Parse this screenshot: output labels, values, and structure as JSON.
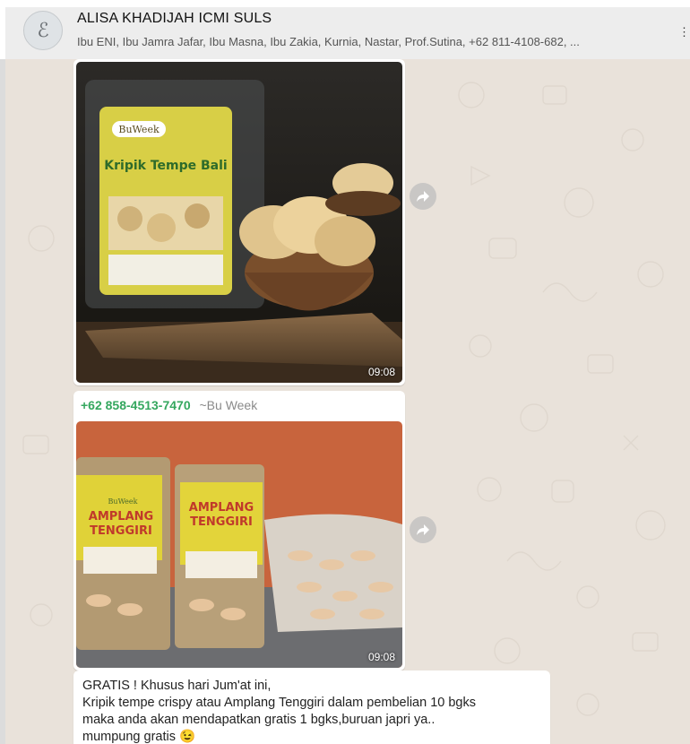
{
  "header": {
    "avatar_glyph": "ℰ",
    "title": "ALISA KHADIJAH ICMI SULS",
    "participants": "Ibu ENI, Ibu Jamra Jafar, Ibu Masna, Ibu Zakia, Kurnia, Nastar, Prof.Sutina, +62 811-4108-682, ..."
  },
  "messages": {
    "first_image": {
      "time": "09:08",
      "package_brand": "BuWeek",
      "package_label": "Kripik Tempe Bali"
    },
    "second": {
      "sender_phone": "+62 858-4513-7470",
      "sender_name": "~Bu Week",
      "time": "09:08",
      "package_brand": "BuWeek",
      "package_label_line1": "AMPLANG",
      "package_label_line2": "TENGGIRI"
    },
    "text": {
      "lines": [
        "GRATIS ! Khusus hari Jum'at ini,",
        "Kripik tempe crispy atau Amplang Tenggiri dalam pembelian 10 bgks",
        "maka anda akan mendapatkan gratis 1 bgks,buruan japri ya..",
        "mumpung gratis 😉"
      ]
    }
  },
  "colors": {
    "chat_background": "#e9e2da",
    "sender_phone": "#35a75f",
    "header_background": "#ededed"
  }
}
